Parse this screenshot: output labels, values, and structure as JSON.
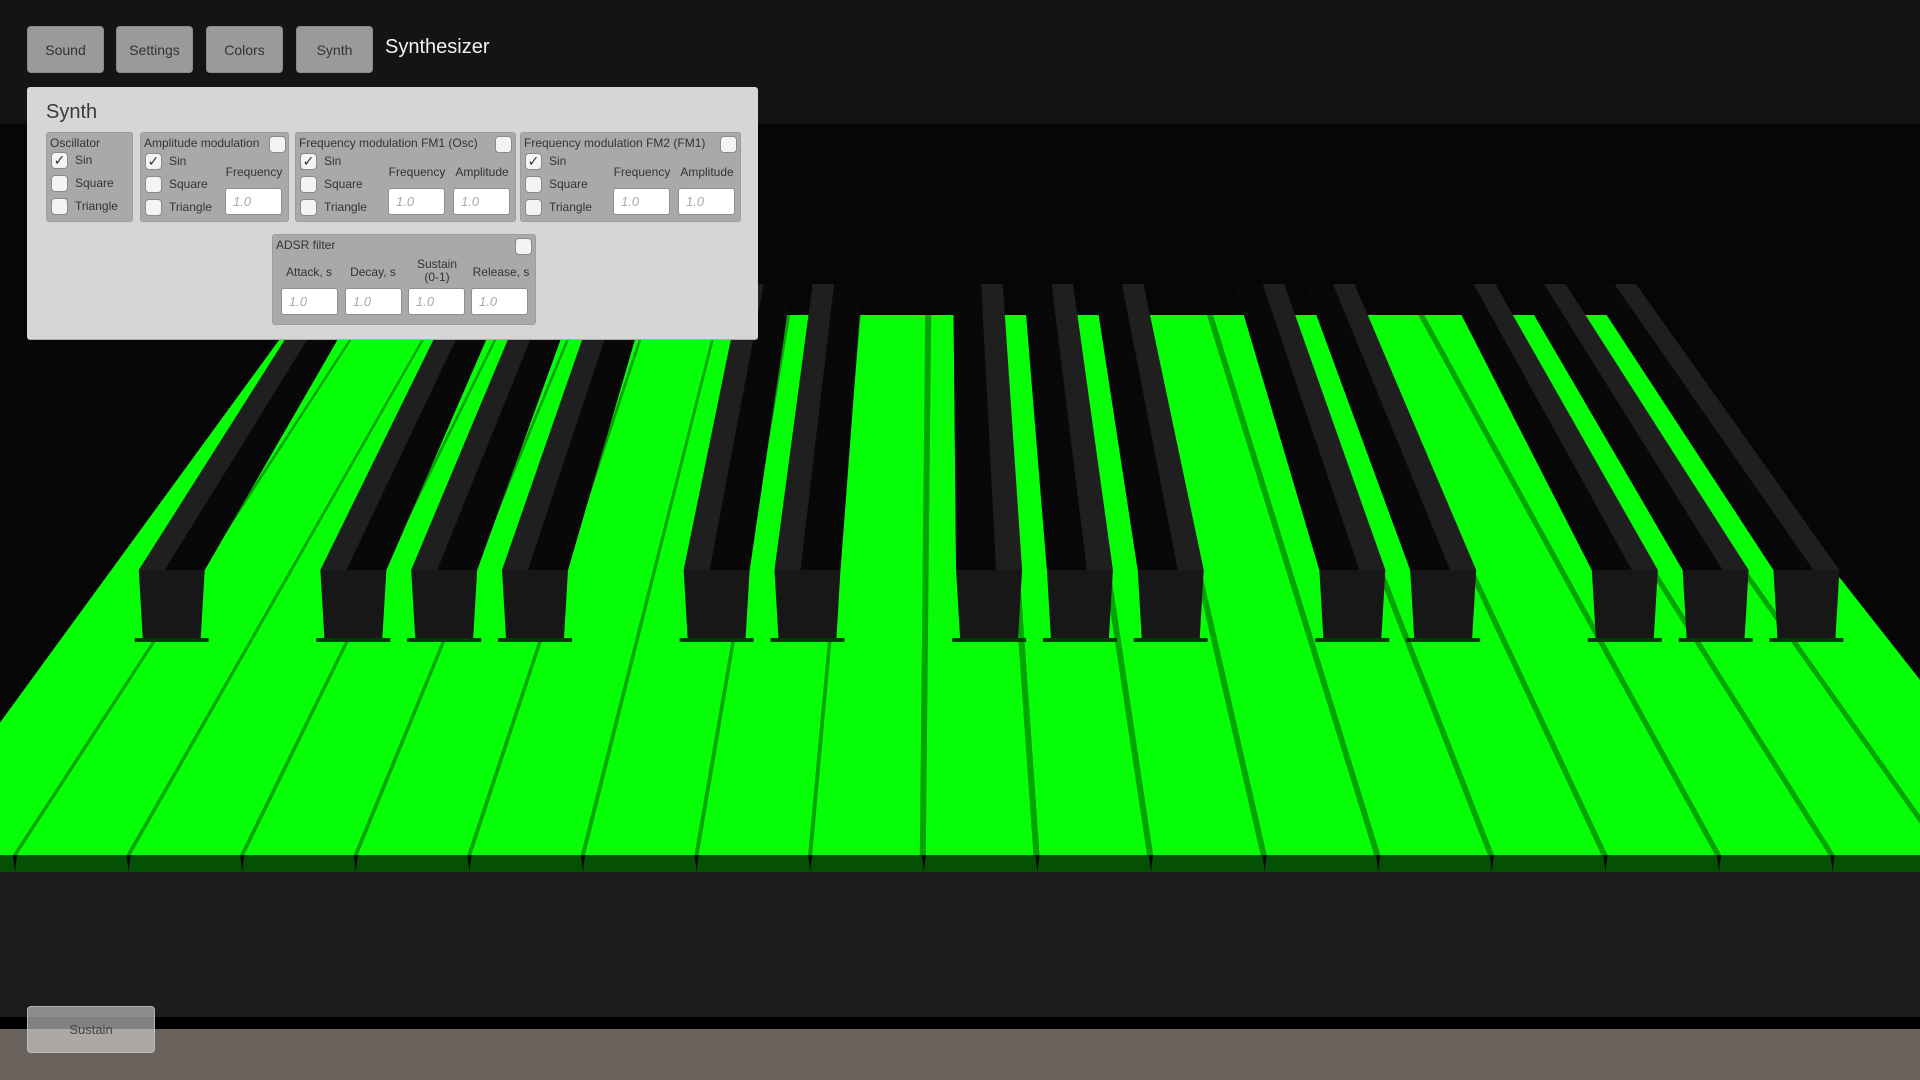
{
  "nav": {
    "buttons": [
      {
        "id": "sound",
        "label": "Sound"
      },
      {
        "id": "settings",
        "label": "Settings"
      },
      {
        "id": "colors",
        "label": "Colors"
      },
      {
        "id": "synth",
        "label": "Synth"
      }
    ],
    "title": "Synthesizer"
  },
  "synth_panel": {
    "title": "Synth",
    "oscillator": {
      "title": "Oscillator",
      "options": [
        {
          "label": "Sin",
          "checked": true
        },
        {
          "label": "Square",
          "checked": false
        },
        {
          "label": "Triangle",
          "checked": false
        }
      ]
    },
    "amplitude_modulation": {
      "title": "Amplitude modulation",
      "enabled": false,
      "options": [
        {
          "label": "Sin",
          "checked": true
        },
        {
          "label": "Square",
          "checked": false
        },
        {
          "label": "Triangle",
          "checked": false
        }
      ],
      "frequency_label": "Frequency",
      "frequency_placeholder": "1.0"
    },
    "fm1": {
      "title": "Frequency modulation FM1 (Osc)",
      "enabled": false,
      "options": [
        {
          "label": "Sin",
          "checked": true
        },
        {
          "label": "Square",
          "checked": false
        },
        {
          "label": "Triangle",
          "checked": false
        }
      ],
      "frequency_label": "Frequency",
      "frequency_placeholder": "1.0",
      "amplitude_label": "Amplitude",
      "amplitude_placeholder": "1.0"
    },
    "fm2": {
      "title": "Frequency modulation FM2 (FM1)",
      "enabled": false,
      "options": [
        {
          "label": "Sin",
          "checked": true
        },
        {
          "label": "Square",
          "checked": false
        },
        {
          "label": "Triangle",
          "checked": false
        }
      ],
      "frequency_label": "Frequency",
      "frequency_placeholder": "1.0",
      "amplitude_label": "Amplitude",
      "amplitude_placeholder": "1.0"
    },
    "adsr": {
      "title": "ADSR filter",
      "enabled": false,
      "attack_label": "Attack, s",
      "attack_placeholder": "1.0",
      "decay_label": "Decay, s",
      "decay_placeholder": "1.0",
      "sustain_label": "Sustain\n(0-1)",
      "sustain_placeholder": "1.0",
      "release_label": "Release, s",
      "release_placeholder": "1.0"
    }
  },
  "keyboard": {
    "white_key_color": "#06ff06",
    "white_key_side_color": "#045004",
    "black_key_color": "#1f1f1f",
    "white_keys_visible": 18,
    "black_key_pattern": [
      "C#",
      "D#",
      "F#",
      "G#",
      "A#"
    ],
    "checkmark_icon": "✓"
  },
  "sustain_button": {
    "label": "Sustain"
  },
  "colors": {
    "top_band": "#141414",
    "background": "#060606",
    "board": "#1c1c1c",
    "floor": "#6a625c",
    "panel": "#d6d6d6",
    "group": "#a9a9a9",
    "button": "#9a9a9a"
  }
}
